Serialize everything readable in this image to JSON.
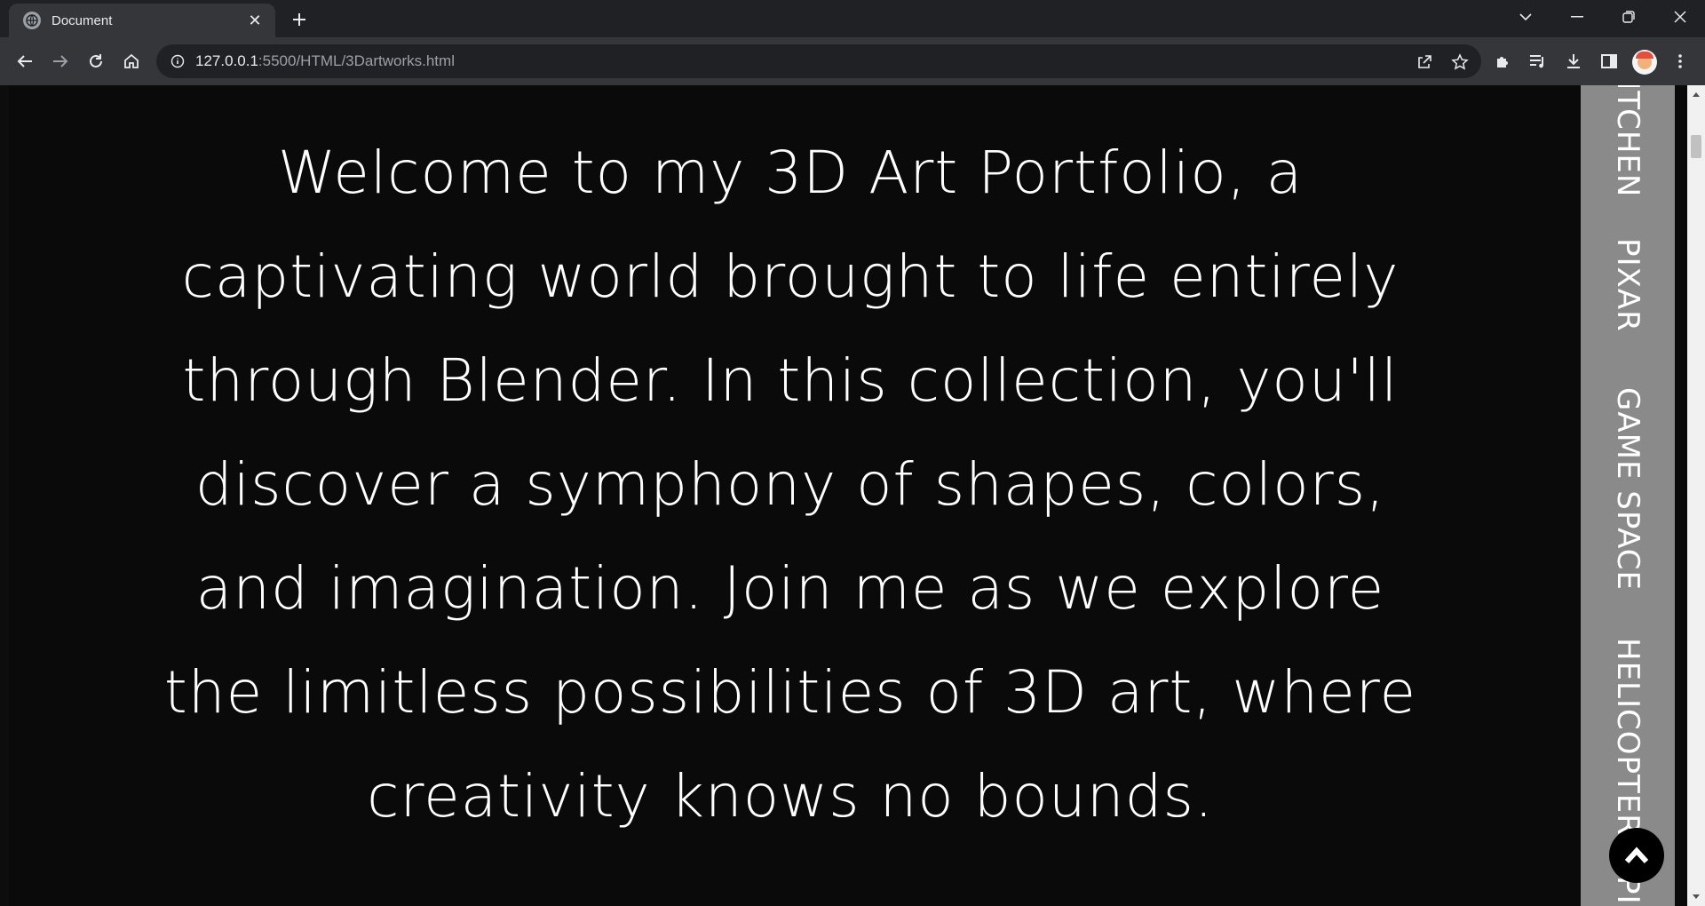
{
  "browser": {
    "tab_title": "Document",
    "url_host": "127.0.0.1",
    "url_rest": ":5500/HTML/3Dartworks.html"
  },
  "page": {
    "intro_text": "Welcome to my 3D Art Portfolio, a captivating world brought to life entirely through Blender. In this collection, you'll discover a symphony of shapes, colors, and imagination. Join me as we explore the limitless possibilities of 3D art, where creativity knows no bounds.",
    "side_nav": [
      "KITCHEN",
      "PIXAR",
      "GAME SPACE",
      "HELICOPTER",
      "PI"
    ]
  },
  "colors": {
    "page_background": "#0a0a0a",
    "sidebar": "#8a8a8a",
    "text": "#ffffff"
  }
}
